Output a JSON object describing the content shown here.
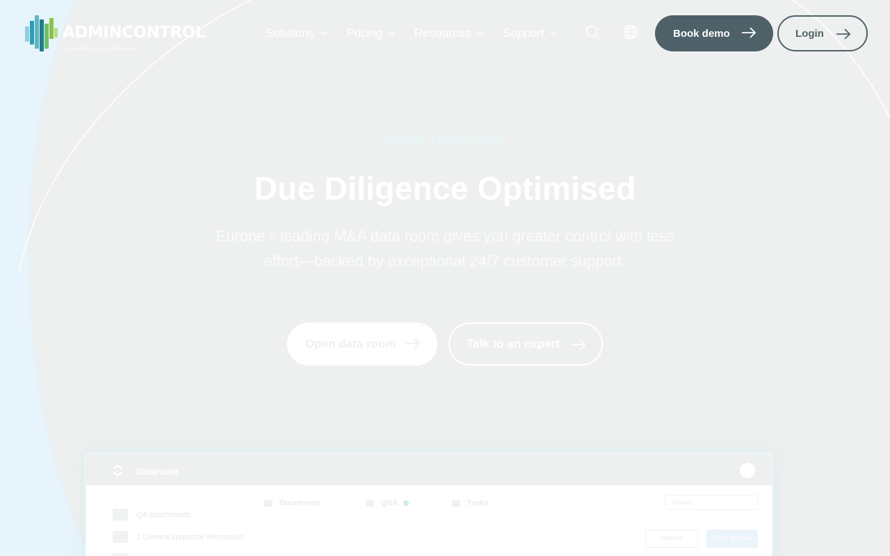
{
  "brand": {
    "name": "ADMINCONTROL",
    "tagline": "A RAVENSEIL COMPANY"
  },
  "nav": {
    "items": [
      {
        "label": "Solutions"
      },
      {
        "label": "Pricing"
      },
      {
        "label": "Resources"
      },
      {
        "label": "Support"
      }
    ],
    "search_icon": "search-icon",
    "language_icon": "globe-icon",
    "book_demo_label": "Book demo",
    "login_label": "Login"
  },
  "hero": {
    "eyebrow": "Virtual Data Room",
    "title": "Due Diligence Optimised",
    "subtitle": "Europe’s leading M&A data room gives you greater control with less effort—backed by exceptional 24/7 customer support.",
    "cta_primary": "Open data room",
    "cta_secondary": "Talk to an expert"
  },
  "preview": {
    "app_title": "Dataroom",
    "tabs": [
      {
        "label": "Documents"
      },
      {
        "label": "Q&A"
      },
      {
        "label": "Tasks"
      }
    ],
    "search_placeholder": "Search",
    "rows": [
      {
        "label": "QA attachments"
      },
      {
        "label": "1 General corporate information"
      },
      {
        "label": ""
      }
    ],
    "button_secondary": "Upload",
    "button_primary": "More actions"
  },
  "colors": {
    "background": "#eef0ef",
    "button_dark": "#4e6169",
    "logo_teal": "#1f8fa0",
    "logo_green": "#8bc34a"
  }
}
